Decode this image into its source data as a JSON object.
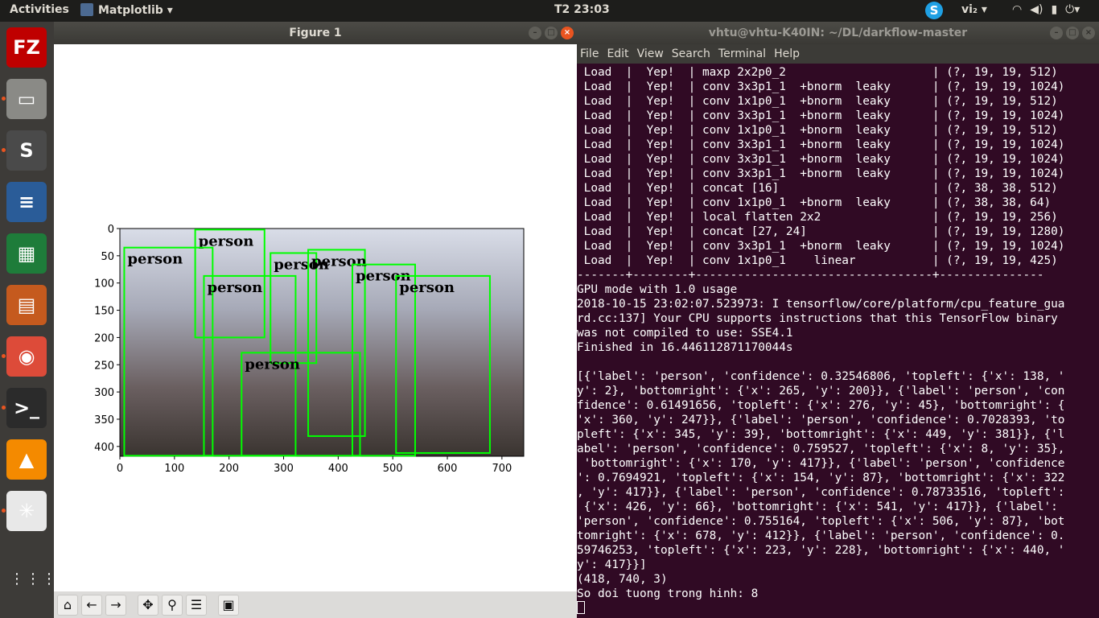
{
  "topbar": {
    "activities": "Activities",
    "app_menu": "Matplotlib ▾",
    "clock": "T2 23:03",
    "skype": "S",
    "language": "vi₂ ▾",
    "tray_icons": [
      "wifi-icon",
      "volume-icon",
      "battery-icon",
      "chevron-down-icon"
    ]
  },
  "dock": {
    "items": [
      {
        "name": "filezilla",
        "glyph": "FZ",
        "color": "#bf0000"
      },
      {
        "name": "files",
        "glyph": "▭",
        "color": "#8a8a86"
      },
      {
        "name": "sublime-text",
        "glyph": "S",
        "color": "#4a4a4a"
      },
      {
        "name": "libreoffice-writer",
        "glyph": "≡",
        "color": "#2a5c98"
      },
      {
        "name": "libreoffice-calc",
        "glyph": "▦",
        "color": "#1e7c3a"
      },
      {
        "name": "libreoffice-impress",
        "glyph": "▤",
        "color": "#c55a1e"
      },
      {
        "name": "chrome",
        "glyph": "◉",
        "color": "#dd4b39"
      },
      {
        "name": "terminal",
        "glyph": ">_",
        "color": "#2b2b2b"
      },
      {
        "name": "vlc",
        "glyph": "▲",
        "color": "#f48a00"
      },
      {
        "name": "matplotlib",
        "glyph": "✳",
        "color": "#e8e8e8"
      }
    ],
    "show_apps": "⋮⋮⋮"
  },
  "figure": {
    "title": "Figure 1",
    "buttons": [
      "–",
      "□",
      "×"
    ],
    "image_description_colors": {
      "box": "#00ff00"
    },
    "x_ticks": [
      "0",
      "100",
      "200",
      "300",
      "400",
      "500",
      "600",
      "700"
    ],
    "y_ticks": [
      "0",
      "50",
      "100",
      "150",
      "200",
      "250",
      "300",
      "350",
      "400"
    ],
    "image_width": 740,
    "image_height": 418,
    "label": "person",
    "detections": [
      {
        "label": "person",
        "x1": 138,
        "y1": 2,
        "x2": 265,
        "y2": 200
      },
      {
        "label": "person",
        "x1": 276,
        "y1": 45,
        "x2": 360,
        "y2": 247
      },
      {
        "label": "person",
        "x1": 345,
        "y1": 39,
        "x2": 449,
        "y2": 381
      },
      {
        "label": "person",
        "x1": 8,
        "y1": 35,
        "x2": 170,
        "y2": 417
      },
      {
        "label": "person",
        "x1": 154,
        "y1": 87,
        "x2": 322,
        "y2": 417
      },
      {
        "label": "person",
        "x1": 426,
        "y1": 66,
        "x2": 541,
        "y2": 417
      },
      {
        "label": "person",
        "x1": 506,
        "y1": 87,
        "x2": 678,
        "y2": 412
      },
      {
        "label": "person",
        "x1": 223,
        "y1": 228,
        "x2": 440,
        "y2": 417
      }
    ],
    "toolbar": [
      "home-icon",
      "back-icon",
      "forward-icon",
      "pan-icon",
      "zoom-icon",
      "configure-icon",
      "save-icon"
    ]
  },
  "terminal": {
    "title": "vhtu@vhtu-K40IN: ~/DL/darkflow-master",
    "menu": [
      "File",
      "Edit",
      "View",
      "Search",
      "Terminal",
      "Help"
    ],
    "lines": [
      " Load  |  Yep!  | maxp 2x2p0_2                     | (?, 19, 19, 512)",
      " Load  |  Yep!  | conv 3x3p1_1  +bnorm  leaky      | (?, 19, 19, 1024)",
      " Load  |  Yep!  | conv 1x1p0_1  +bnorm  leaky      | (?, 19, 19, 512)",
      " Load  |  Yep!  | conv 3x3p1_1  +bnorm  leaky      | (?, 19, 19, 1024)",
      " Load  |  Yep!  | conv 1x1p0_1  +bnorm  leaky      | (?, 19, 19, 512)",
      " Load  |  Yep!  | conv 3x3p1_1  +bnorm  leaky      | (?, 19, 19, 1024)",
      " Load  |  Yep!  | conv 3x3p1_1  +bnorm  leaky      | (?, 19, 19, 1024)",
      " Load  |  Yep!  | conv 3x3p1_1  +bnorm  leaky      | (?, 19, 19, 1024)",
      " Load  |  Yep!  | concat [16]                      | (?, 38, 38, 512)",
      " Load  |  Yep!  | conv 1x1p0_1  +bnorm  leaky      | (?, 38, 38, 64)",
      " Load  |  Yep!  | local flatten 2x2                | (?, 19, 19, 256)",
      " Load  |  Yep!  | concat [27, 24]                  | (?, 19, 19, 1280)",
      " Load  |  Yep!  | conv 3x3p1_1  +bnorm  leaky      | (?, 19, 19, 1024)",
      " Load  |  Yep!  | conv 1x1p0_1    linear           | (?, 19, 19, 425)",
      "-------+--------+----------------------------------+---------------",
      "GPU mode with 1.0 usage",
      "2018-10-15 23:02:07.523973: I tensorflow/core/platform/cpu_feature_gua",
      "rd.cc:137] Your CPU supports instructions that this TensorFlow binary",
      "was not compiled to use: SSE4.1",
      "Finished in 16.446112871170044s",
      "",
      "[{'label': 'person', 'confidence': 0.32546806, 'topleft': {'x': 138, '",
      "y': 2}, 'bottomright': {'x': 265, 'y': 200}}, {'label': 'person', 'con",
      "fidence': 0.61491656, 'topleft': {'x': 276, 'y': 45}, 'bottomright': {",
      "'x': 360, 'y': 247}}, {'label': 'person', 'confidence': 0.7028393, 'to",
      "pleft': {'x': 345, 'y': 39}, 'bottomright': {'x': 449, 'y': 381}}, {'l",
      "abel': 'person', 'confidence': 0.759527, 'topleft': {'x': 8, 'y': 35},",
      " 'bottomright': {'x': 170, 'y': 417}}, {'label': 'person', 'confidence",
      "': 0.7694921, 'topleft': {'x': 154, 'y': 87}, 'bottomright': {'x': 322",
      ", 'y': 417}}, {'label': 'person', 'confidence': 0.78733516, 'topleft':",
      " {'x': 426, 'y': 66}, 'bottomright': {'x': 541, 'y': 417}}, {'label':",
      "'person', 'confidence': 0.755164, 'topleft': {'x': 506, 'y': 87}, 'bot",
      "tomright': {'x': 678, 'y': 412}}, {'label': 'person', 'confidence': 0.",
      "59746253, 'topleft': {'x': 223, 'y': 228}, 'bottomright': {'x': 440, '",
      "y': 417}}]",
      "(418, 740, 3)",
      "So doi tuong trong hinh: 8"
    ]
  }
}
